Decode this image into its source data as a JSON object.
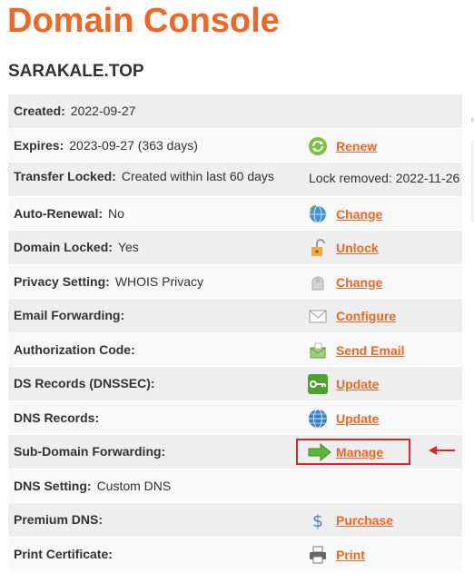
{
  "header": {
    "title": "Domain Console",
    "domain": "SARAKALE.TOP"
  },
  "colors": {
    "accent": "#f26522",
    "highlight_border": "#d9262c"
  },
  "rows": [
    {
      "label": "Created:",
      "value": "2022-09-27"
    },
    {
      "label": "Expires:",
      "value": "2023-09-27 (363 days)",
      "action": "Renew",
      "icon": "renew-icon"
    },
    {
      "label": "Transfer Locked:",
      "value": "Created within last 60 days",
      "note": "Lock removed: 2022-11-26"
    },
    {
      "label": "Auto-Renewal:",
      "value": "No",
      "action": "Change",
      "icon": "globe-refresh-icon"
    },
    {
      "label": "Domain Locked:",
      "value": "Yes",
      "action": "Unlock",
      "icon": "padlock-icon"
    },
    {
      "label": "Privacy Setting:",
      "value": "WHOIS Privacy",
      "action": "Change",
      "icon": "privacy-icon"
    },
    {
      "label": "Email Forwarding:",
      "value": "",
      "action": "Configure",
      "icon": "envelope-icon"
    },
    {
      "label": "Authorization Code:",
      "value": "",
      "action": "Send Email",
      "icon": "send-email-icon"
    },
    {
      "label": "DS Records (DNSSEC):",
      "value": "",
      "action": "Update",
      "icon": "key-icon"
    },
    {
      "label": "DNS Records:",
      "value": "",
      "action": "Update",
      "icon": "globe-icon"
    },
    {
      "label": "Sub-Domain Forwarding:",
      "value": "",
      "action": "Manage",
      "icon": "forward-arrow-icon"
    },
    {
      "label": "DNS Setting:",
      "value": "Custom DNS"
    },
    {
      "label": "Premium DNS:",
      "value": "",
      "action": "Purchase",
      "icon": "dollar-icon"
    },
    {
      "label": "Print Certificate:",
      "value": "",
      "action": "Print",
      "icon": "printer-icon"
    }
  ]
}
